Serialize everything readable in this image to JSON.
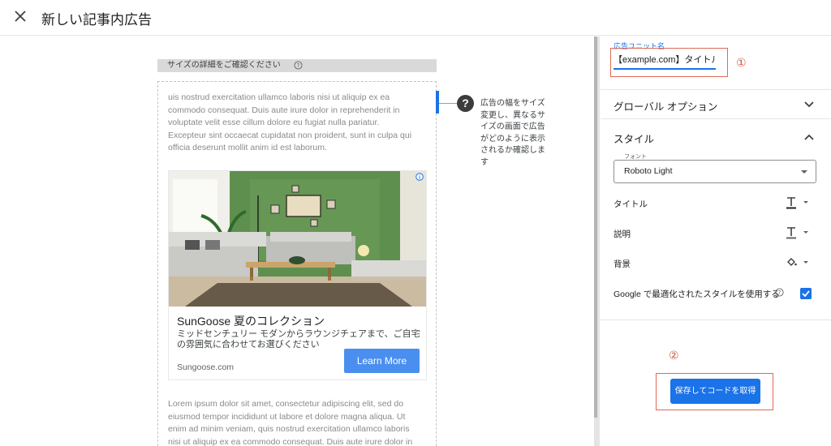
{
  "header": {
    "title": "新しい記事内広告"
  },
  "preview": {
    "size_hint": "サイズの詳細をご確認ください",
    "lorem_top": "uis nostrud exercitation ullamco laboris nisi ut aliquip ex ea commodo consequat. Duis aute irure dolor in reprehenderit in voluptate velit esse cillum dolore eu fugiat nulla pariatur. Excepteur sint occaecat cupidatat non proident, sunt in culpa qui officia deserunt mollit anim id est laborum.",
    "lorem_bottom": "Lorem ipsum dolor sit amet, consectetur adipiscing elit, sed do eiusmod tempor incididunt ut labore et dolore magna aliqua. Ut enim ad minim veniam, quis nostrud exercitation ullamco laboris nisi ut aliquip ex ea commodo consequat. Duis aute irure dolor in",
    "help_text": "広告の幅をサイズ変更し、異なるサイズの画面で広告がどのように表示されるか確認します",
    "ad": {
      "title": "SunGoose 夏のコレクション",
      "description": "ミッドセンチュリー モダンからラウンジチェアまで、ご自宅の雰囲気に合わせてお選びください",
      "domain": "Sungoose.com",
      "cta": "Learn More"
    }
  },
  "settings": {
    "unit_name_label": "広告ユニット名",
    "unit_name_value": "【example.com】タイトル下",
    "annotation_1": "①",
    "global_options": "グローバル オプション",
    "style_section": "スタイル",
    "font_label": "フォント",
    "font_value": "Roboto Light",
    "title_label": "タイトル",
    "description_label": "説明",
    "background_label": "背景",
    "google_optimized": "Google で最適化されたスタイルを使用する",
    "annotation_2": "②",
    "save_button": "保存してコードを取得"
  },
  "colors": {
    "accent": "#1a73e8",
    "annotation": "#e06a55",
    "cta": "#4a8ff0"
  }
}
